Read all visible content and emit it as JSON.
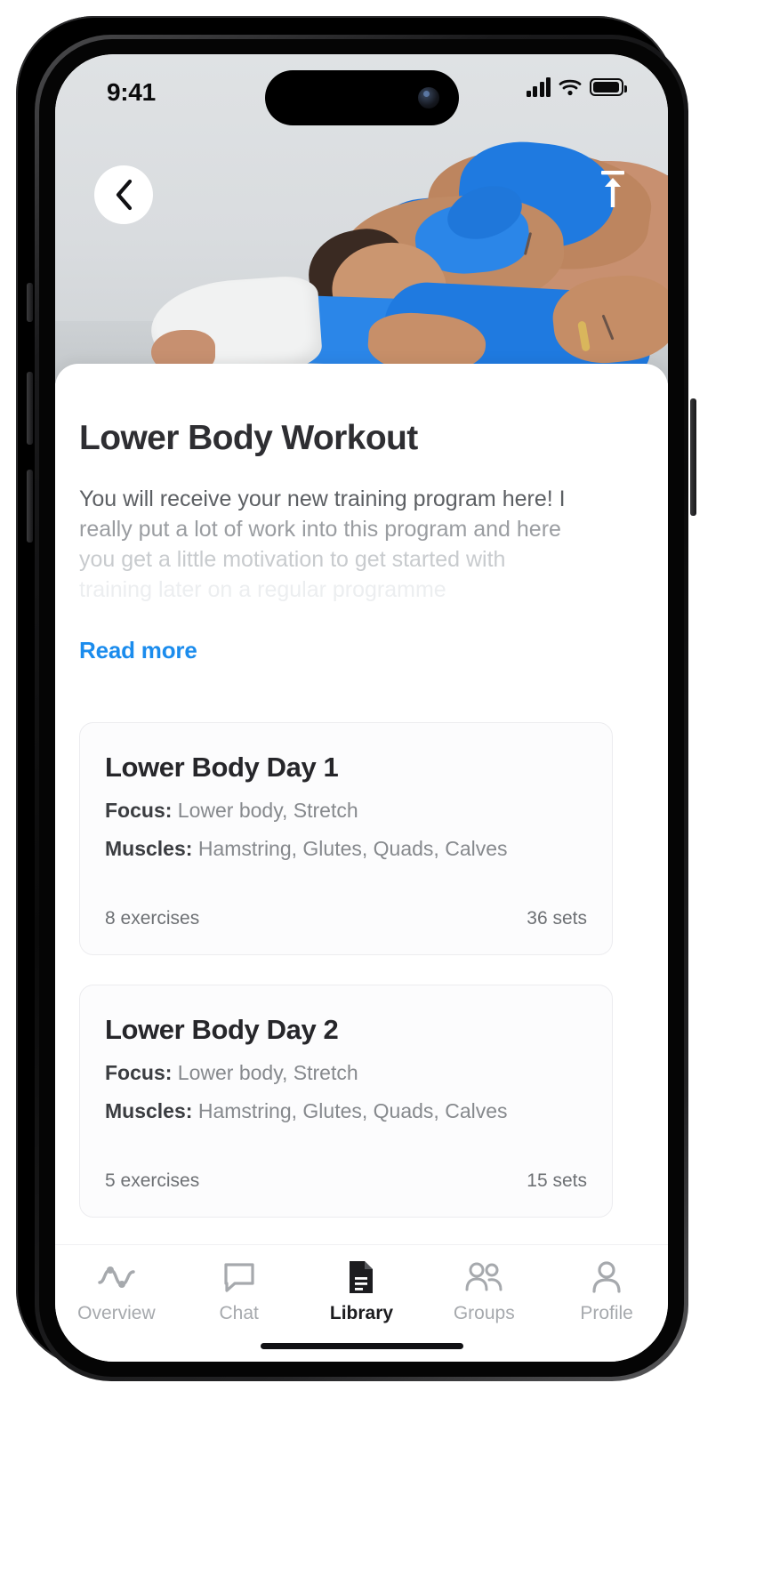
{
  "status_bar": {
    "time": "9:41",
    "icons": [
      "signal-icon",
      "wifi-icon",
      "battery-icon"
    ]
  },
  "hero": {
    "back_icon": "chevron-left-icon",
    "share_icon": "share-upload-icon",
    "alt": "Woman in blue activewear lying on floor stretching"
  },
  "detail": {
    "title": "Lower Body Workout",
    "description_lines": [
      "You will receive your new training program here! I",
      "really put a lot of work into this program and here",
      "you get a little motivation to get started with",
      "training later on a regular programme"
    ],
    "read_more_label": "Read more",
    "read_more_color": "#1b8ced"
  },
  "workout_cards": [
    {
      "title": "Lower Body Day 1",
      "focus_label": "Focus:",
      "focus_value": " Lower body, Stretch",
      "muscles_label": "Muscles:",
      "muscles_value": " Hamstring, Glutes, Quads, Calves",
      "exercises": "8 exercises",
      "sets": "36 sets"
    },
    {
      "title": "Lower Body Day 2",
      "focus_label": "Focus:",
      "focus_value": " Lower body, Stretch",
      "muscles_label": "Muscles:",
      "muscles_value": " Hamstring, Glutes, Quads, Calves",
      "exercises": "5 exercises",
      "sets": "15 sets"
    }
  ],
  "tab_bar": {
    "active_index": 2,
    "items": [
      {
        "label": "Overview",
        "icon": "activity-pulse-icon"
      },
      {
        "label": "Chat",
        "icon": "chat-bubble-icon"
      },
      {
        "label": "Library",
        "icon": "document-icon"
      },
      {
        "label": "Groups",
        "icon": "people-group-icon"
      },
      {
        "label": "Profile",
        "icon": "person-icon"
      }
    ]
  }
}
